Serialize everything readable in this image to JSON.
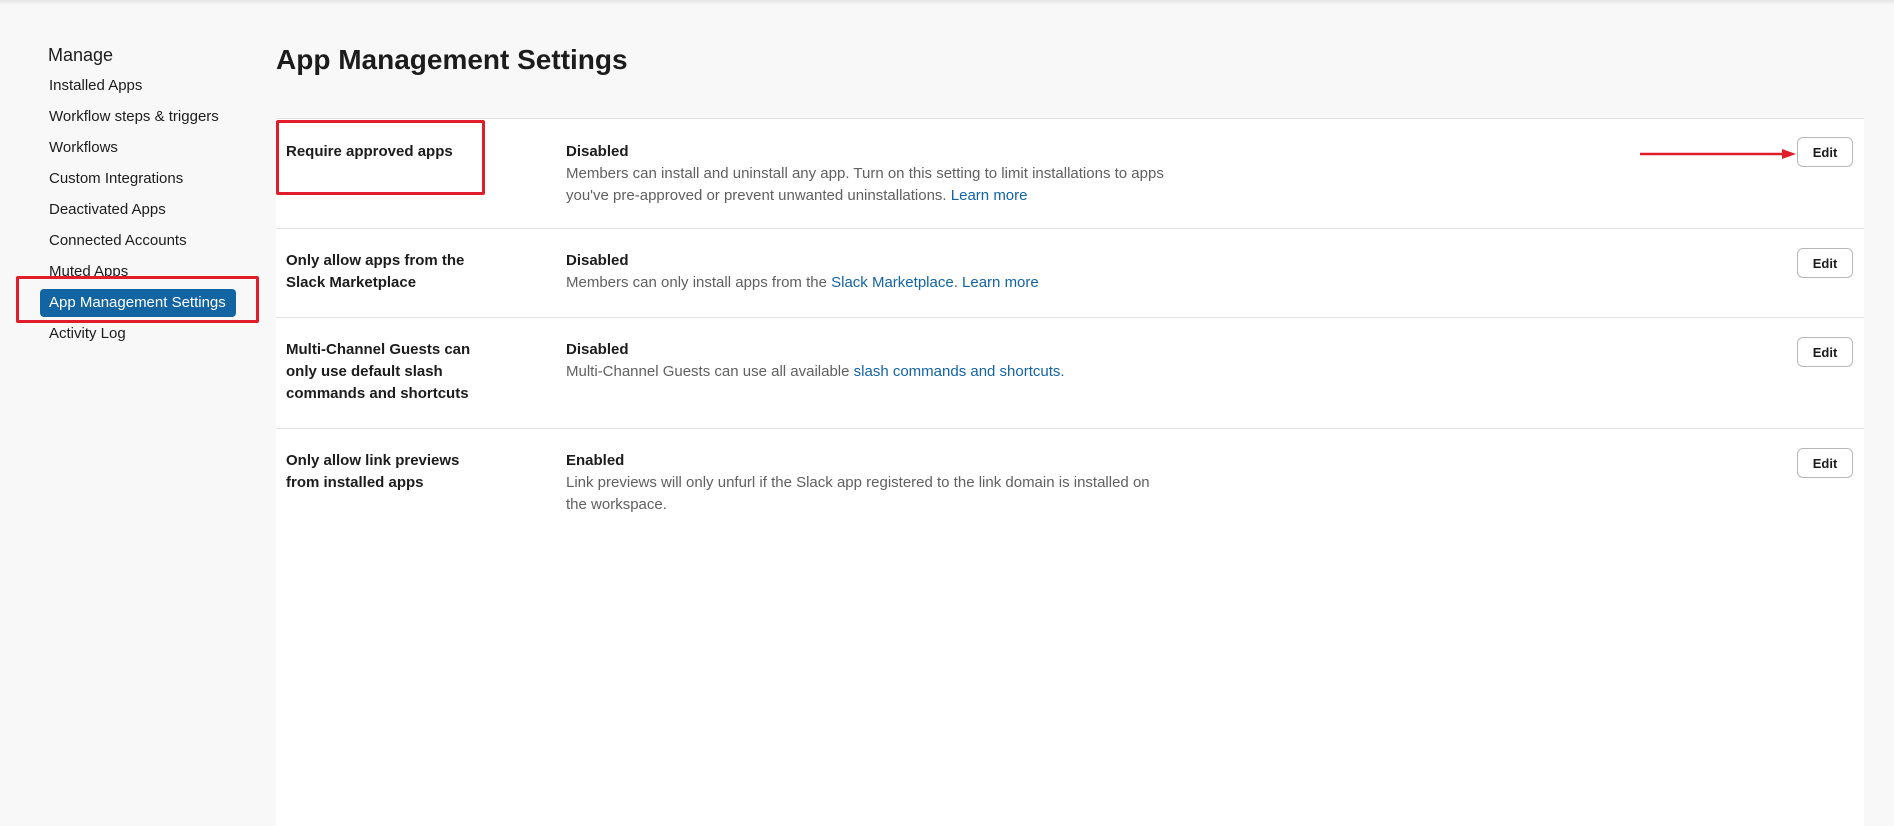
{
  "sidebar": {
    "heading": "Manage",
    "items": [
      {
        "label": "Installed Apps"
      },
      {
        "label": "Workflow steps & triggers"
      },
      {
        "label": "Workflows"
      },
      {
        "label": "Custom Integrations"
      },
      {
        "label": "Deactivated Apps"
      },
      {
        "label": "Connected Accounts"
      },
      {
        "label": "Muted Apps"
      },
      {
        "label": "App Management Settings",
        "active": true
      },
      {
        "label": "Activity Log"
      }
    ]
  },
  "main": {
    "title": "App Management Settings",
    "settings": [
      {
        "name": "Require approved apps",
        "status": "Disabled",
        "desc_text": "Members can install and uninstall any app. Turn on this setting to limit installations to apps you've pre-approved or prevent unwanted uninstallations.",
        "link1": "Learn more",
        "edit_label": "Edit"
      },
      {
        "name": "Only allow apps from the Slack Marketplace",
        "status": "Disabled",
        "desc_text": "Members can only install apps from the",
        "link1": "Slack Marketplace",
        "desc_mid": ".",
        "link2": "Learn more",
        "edit_label": "Edit"
      },
      {
        "name": "Multi-Channel Guests can only use default slash commands and shortcuts",
        "status": "Disabled",
        "desc_text": "Multi-Channel Guests can use all available",
        "link1": "slash commands and shortcuts.",
        "edit_label": "Edit"
      },
      {
        "name": "Only allow link previews from installed apps",
        "status": "Enabled",
        "desc_text": "Link previews will only unfurl if the Slack app registered to the link domain is installed on the workspace.",
        "edit_label": "Edit"
      }
    ]
  },
  "annotations": {
    "highlight_color": "#e01e2b",
    "accent_color": "#1264a3"
  }
}
